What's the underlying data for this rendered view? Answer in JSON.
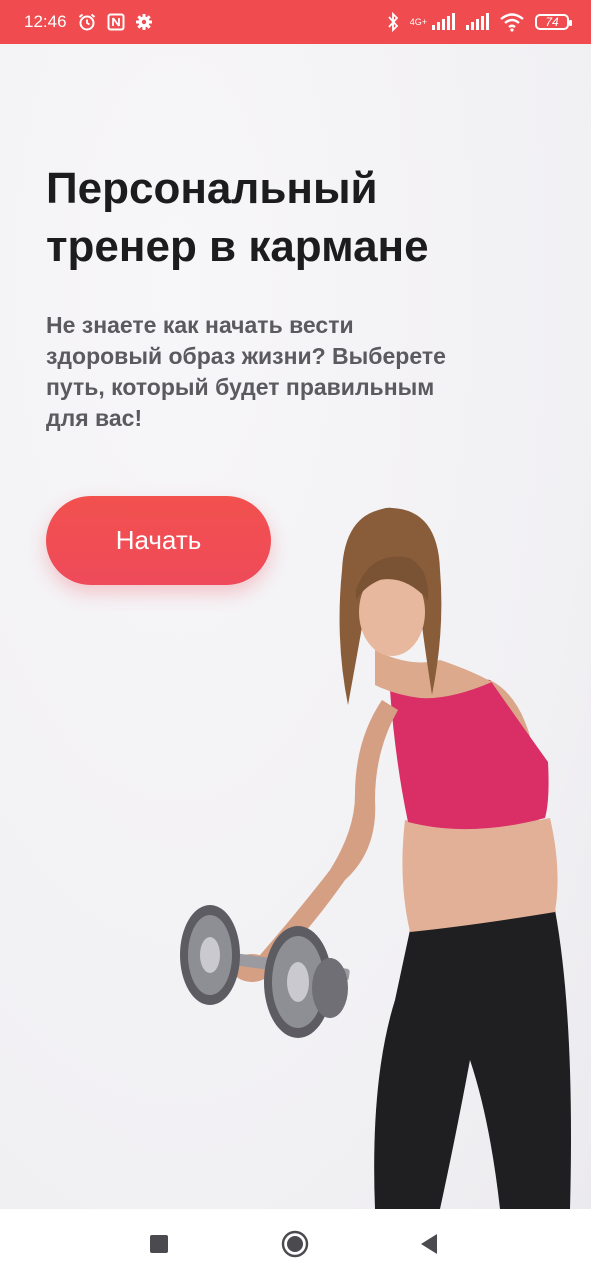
{
  "status_bar": {
    "time": "12:46",
    "network_label": "4G+",
    "battery_level": "74",
    "icons": [
      "alarm-icon",
      "nfc-icon",
      "settings-gear-icon",
      "bluetooth-icon",
      "signal-icon",
      "signal-icon",
      "wifi-icon",
      "battery-icon"
    ]
  },
  "main": {
    "title": "Персональный тренер в кармане",
    "subtitle": "Не знаете как начать вести здоровый образ жизни? Выберете путь, который будет правильным для вас!",
    "start_button_label": "Начать"
  },
  "hero_image": {
    "description_icon": "woman-with-dumbbell-illustration"
  },
  "nav_bar": {
    "icons": [
      "recent-apps-square-icon",
      "home-circle-icon",
      "back-triangle-icon"
    ]
  },
  "colors": {
    "accent": "#f04b4e",
    "button_gradient_end": "#ee4a5a",
    "title": "#1c1b1d",
    "subtitle": "#5b5b5f",
    "background": "#f3f2f4"
  }
}
